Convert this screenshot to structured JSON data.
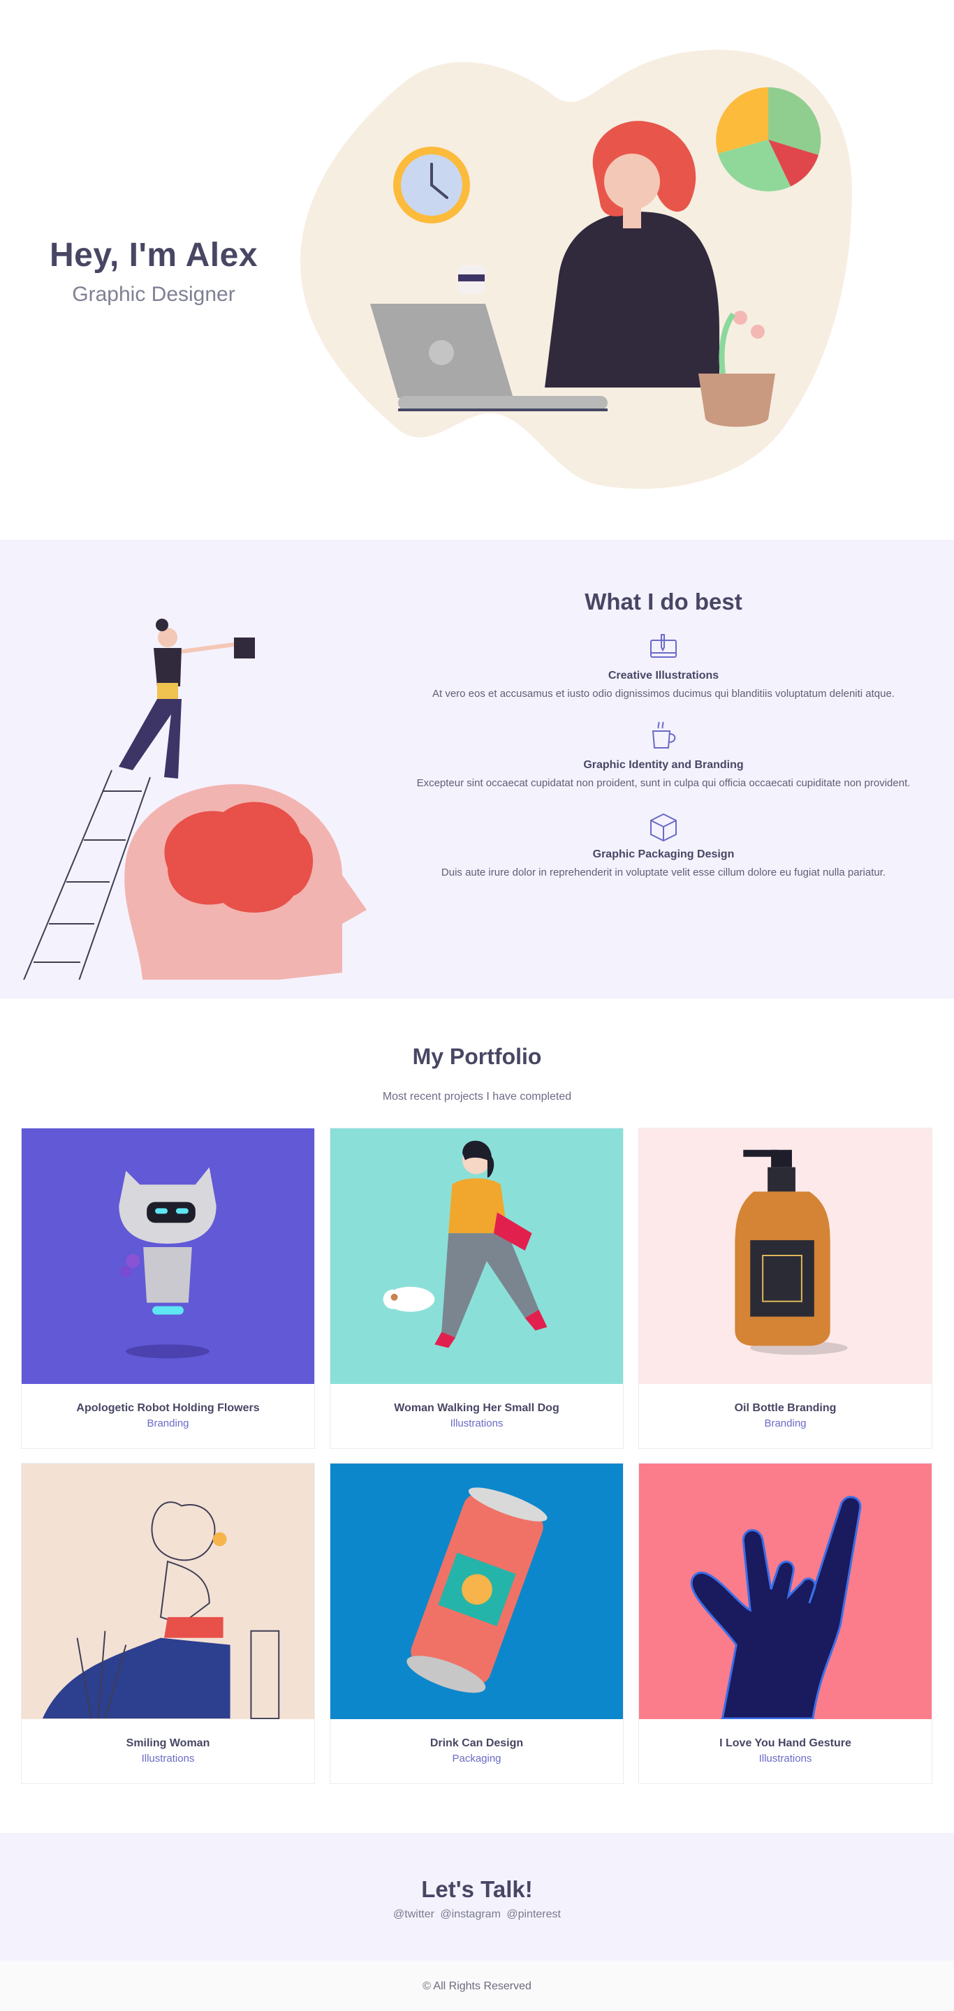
{
  "hero": {
    "name": "Hey, I'm Alex",
    "role": "Graphic Designer"
  },
  "services": {
    "title": "What I do best",
    "items": [
      {
        "icon": "illustration-tablet-icon",
        "title": "Creative Illustrations",
        "desc": "At vero eos et accusamus et iusto odio dignissimos ducimus qui blanditiis voluptatum deleniti atque."
      },
      {
        "icon": "identity-mug-icon",
        "title": "Graphic Identity and Branding",
        "desc": "Excepteur sint occaecat cupidatat non proident, sunt in culpa qui officia occaecati cupiditate non provident."
      },
      {
        "icon": "package-box-icon",
        "title": "Graphic Packaging Design",
        "desc": "Duis aute irure dolor in reprehenderit in voluptate velit esse cillum dolore eu fugiat nulla pariatur."
      }
    ]
  },
  "portfolio": {
    "title": "My Portfolio",
    "subtitle": "Most recent projects I have completed",
    "items": [
      {
        "title": "Apologetic Robot Holding Flowers",
        "category": "Branding",
        "bg": "#6159d6"
      },
      {
        "title": "Woman Walking Her Small Dog",
        "category": "Illustrations",
        "bg": "#8ae0d8"
      },
      {
        "title": "Oil Bottle Branding",
        "category": "Branding",
        "bg": "#fde9ea"
      },
      {
        "title": "Smiling Woman",
        "category": "Illustrations",
        "bg": "#f3e1d4"
      },
      {
        "title": "Drink Can Design",
        "category": "Packaging",
        "bg": "#0d87cb"
      },
      {
        "title": "I Love You Hand Gesture",
        "category": "Illustrations",
        "bg": "#fb7c8b"
      }
    ]
  },
  "contact": {
    "title": "Let's Talk!",
    "links": [
      "@twitter",
      "@instagram",
      "@pinterest"
    ]
  },
  "footer": {
    "text": "© All Rights Reserved"
  },
  "colors": {
    "accent": "#6a6ac8",
    "heading": "#474764",
    "section_bg": "#f4f2fd"
  }
}
